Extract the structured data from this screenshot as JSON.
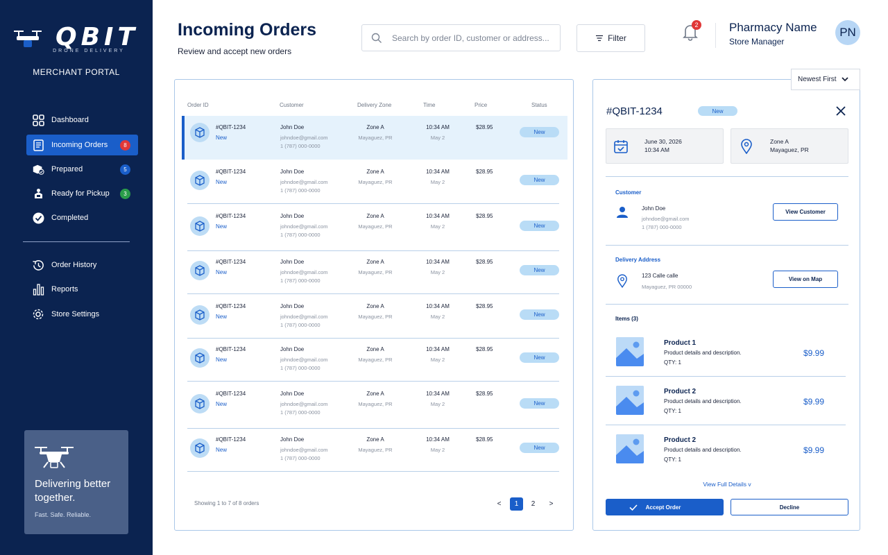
{
  "sidebar": {
    "logo_text": "QBIT",
    "logo_sub": "DRONE DELIVERY",
    "portal": "MERCHANT PORTAL",
    "nav": [
      {
        "label": "Dashboard",
        "icon": "dashboard-icon",
        "badge": ""
      },
      {
        "label": "Incoming Orders",
        "icon": "incoming-orders-icon",
        "badge": "8",
        "badge_color": "#e03838",
        "active": true
      },
      {
        "label": "Prepared",
        "icon": "prepared-icon",
        "badge": "5",
        "badge_color": "#1a5ec9"
      },
      {
        "label": "Ready for Pickup",
        "icon": "ready-for-pickup-icon",
        "badge": "3",
        "badge_color": "#2a9d4a"
      },
      {
        "label": "Completed",
        "icon": "check-circle-icon",
        "badge": ""
      },
      {
        "label": "Order History",
        "icon": "history-icon",
        "badge": ""
      },
      {
        "label": "Reports",
        "icon": "bar-chart-icon",
        "badge": ""
      },
      {
        "label": "Store Settings",
        "icon": "gear-icon",
        "badge": ""
      }
    ],
    "promo": {
      "title": "Delivering better together.",
      "sub": "Fast. Safe. Reliable."
    }
  },
  "header": {
    "title": "Incoming Orders",
    "subtitle": "Review and accept new orders",
    "search_placeholder": "Search by order ID, customer or address...",
    "filter_label": "Filter",
    "notifications": "2",
    "pharmacy_name": "Pharmacy Name",
    "role": "Store Manager",
    "avatar": "PN"
  },
  "sort_label": "Newest First",
  "table": {
    "columns": [
      "Order ID",
      "Customer",
      "Delivery Zone",
      "Time",
      "Price",
      "Status"
    ],
    "rows": [
      {
        "id": "#QBIT-1234",
        "sub": "New",
        "name": "John Doe",
        "email": "johndoe@gmail.com",
        "phone": "1 (787) 000-0000",
        "zone": "Zone A",
        "city": "Mayaguez, PR",
        "time": "10:34 AM",
        "date": "May 2",
        "price": "$28.95",
        "status": "New"
      },
      {
        "id": "#QBIT-1234",
        "sub": "New",
        "name": "John Doe",
        "email": "johndoe@gmail.com",
        "phone": "1 (787) 000-0000",
        "zone": "Zone A",
        "city": "Mayaguez, PR",
        "time": "10:34 AM",
        "date": "May 2",
        "price": "$28.95",
        "status": "New"
      },
      {
        "id": "#QBIT-1234",
        "sub": "New",
        "name": "John Doe",
        "email": "johndoe@gmail.com",
        "phone": "1 (787) 000-0000",
        "zone": "Zone A",
        "city": "Mayaguez, PR",
        "time": "10:34 AM",
        "date": "May 2",
        "price": "$28.95",
        "status": "New"
      },
      {
        "id": "#QBIT-1234",
        "sub": "New",
        "name": "John Doe",
        "email": "johndoe@gmail.com",
        "phone": "1 (787) 000-0000",
        "zone": "Zone A",
        "city": "Mayaguez, PR",
        "time": "10:34 AM",
        "date": "May 2",
        "price": "$28.95",
        "status": "New"
      },
      {
        "id": "#QBIT-1234",
        "sub": "New",
        "name": "John Doe",
        "email": "johndoe@gmail.com",
        "phone": "1 (787) 000-0000",
        "zone": "Zone A",
        "city": "Mayaguez, PR",
        "time": "10:34 AM",
        "date": "May 2",
        "price": "$28.95",
        "status": "New"
      },
      {
        "id": "#QBIT-1234",
        "sub": "New",
        "name": "John Doe",
        "email": "johndoe@gmail.com",
        "phone": "1 (787) 000-0000",
        "zone": "Zone A",
        "city": "Mayaguez, PR",
        "time": "10:34 AM",
        "date": "May 2",
        "price": "$28.95",
        "status": "New"
      },
      {
        "id": "#QBIT-1234",
        "sub": "New",
        "name": "John Doe",
        "email": "johndoe@gmail.com",
        "phone": "1 (787) 000-0000",
        "zone": "Zone A",
        "city": "Mayaguez, PR",
        "time": "10:34 AM",
        "date": "May 2",
        "price": "$28.95",
        "status": "New"
      },
      {
        "id": "#QBIT-1234",
        "sub": "New",
        "name": "John Doe",
        "email": "johndoe@gmail.com",
        "phone": "1 (787) 000-0000",
        "zone": "Zone A",
        "city": "Mayaguez, PR",
        "time": "10:34 AM",
        "date": "May 2",
        "price": "$28.95",
        "status": "New"
      }
    ],
    "showing": "Showing 1 to 7 of 8 orders",
    "pagination": {
      "prev": "<",
      "pages": [
        "1",
        "2"
      ],
      "next": ">",
      "current": "1"
    }
  },
  "detail": {
    "id": "#QBIT-1234",
    "badge": "New",
    "date": "June 30, 2026",
    "time": "10:34 AM",
    "zone": "Zone A",
    "city": "Mayaguez, PR",
    "customer_title": "Customer",
    "customer_name": "John Doe",
    "customer_email": "johndoe@gmail.com",
    "customer_phone": "1 (787) 000-0000",
    "view_customer": "View Customer",
    "address_title": "Delivery Address",
    "address_line": "123 Calle calle",
    "address_city": "Mayaguez, PR 00000",
    "view_map": "View on Map",
    "items_title": "Items (3)",
    "items": [
      {
        "name": "Product 1",
        "desc": "Product details and description.",
        "qty": "QTY: 1",
        "price": "$9.99"
      },
      {
        "name": "Product 2",
        "desc": "Product details and description.",
        "qty": "QTY: 1",
        "price": "$9.99"
      },
      {
        "name": "Product 2",
        "desc": "Product details and description.",
        "qty": "QTY: 1",
        "price": "$9.99"
      }
    ],
    "view_full": "View Full Details v",
    "accept": "Accept Order",
    "decline": "Decline"
  }
}
